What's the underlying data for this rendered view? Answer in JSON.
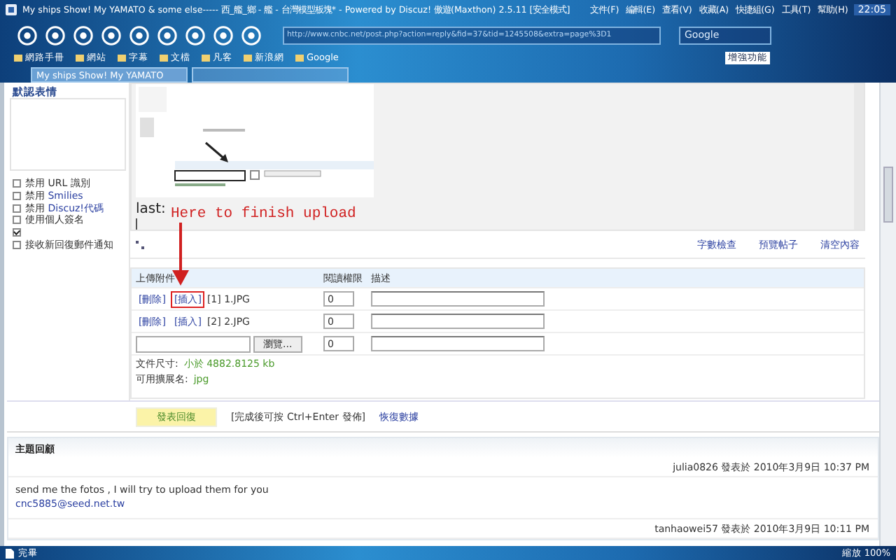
{
  "window": {
    "title": "My ships Show! My YAMATO & some else----- 西_艦_鄉 - 艦 - 台灣模型板塊* - Powered by Discuz!   傲遊(Maxthon) 2.5.11 [安全模式]",
    "menus": [
      "文件(F)",
      "編輯(E)",
      "查看(V)",
      "收藏(A)",
      "快捷組(G)",
      "工具(T)",
      "幫助(H)"
    ],
    "clock": "22:05"
  },
  "toolbar": {
    "address": "http://www.cnbc.net/post.php?action=reply&fid=37&tid=1245508&extra=page%3D1",
    "search": "Google",
    "addon": "增強功能"
  },
  "bookmarks": [
    "網路手冊",
    "網站",
    "字幕",
    "文檔",
    "凡客",
    "新浪網",
    "Google"
  ],
  "tabs": [
    {
      "label": "My ships Show! My YAMATO",
      "selected": true
    },
    {
      "selected": false
    }
  ],
  "smilies": {
    "title": "默認表情"
  },
  "options": [
    {
      "text": "禁用 URL 識別",
      "checked": false
    },
    {
      "text": "禁用",
      "link": "Smilies",
      "checked": false
    },
    {
      "text": "禁用",
      "link": "Discuz!代碼",
      "checked": false
    },
    {
      "text": "使用個人簽名",
      "checked": false
    },
    {
      "checked": true
    },
    {
      "text": "接收新回復郵件通知",
      "checked": false
    }
  ],
  "editor": {
    "text": "last:",
    "annotation": "Here to finish upload",
    "links": [
      "字數檢查",
      "預覽帖子",
      "清空內容"
    ]
  },
  "attachments": {
    "columns": [
      "上傳附件",
      "閱讀權限",
      "描述"
    ],
    "rows": [
      {
        "actions": [
          "[刪除]",
          "[插入]"
        ],
        "name": "[1] 1.JPG",
        "permission": "0",
        "highlighted": true
      },
      {
        "actions": [
          "[刪除]",
          "[插入]"
        ],
        "name": "[2] 2.JPG",
        "permission": "0",
        "highlighted": false
      }
    ],
    "new_row": {
      "browse": "瀏覽...",
      "permission": "0"
    },
    "size_label": "文件尺寸:",
    "size_value": "小於 4882.8125 kb",
    "ext_label": "可用擴展名:",
    "ext_value": "jpg"
  },
  "submit": {
    "button": "發表回復",
    "hint": "[完成後可按 Ctrl+Enter 發佈]",
    "link": "恢復數據"
  },
  "replies": {
    "title": "主題回顧",
    "posts": [
      {
        "author": "julia0826",
        "posted": "發表於  2010年3月9日  10:37 PM",
        "message": "send me the fotos , I will try to upload them for you",
        "email": "cnc5885@seed.net.tw"
      },
      {
        "author": "tanhaowei57",
        "posted": "發表於  2010年3月9日  10:11 PM"
      }
    ]
  },
  "status_bar": {
    "text": "完畢",
    "zoom": "縮放 100%"
  }
}
